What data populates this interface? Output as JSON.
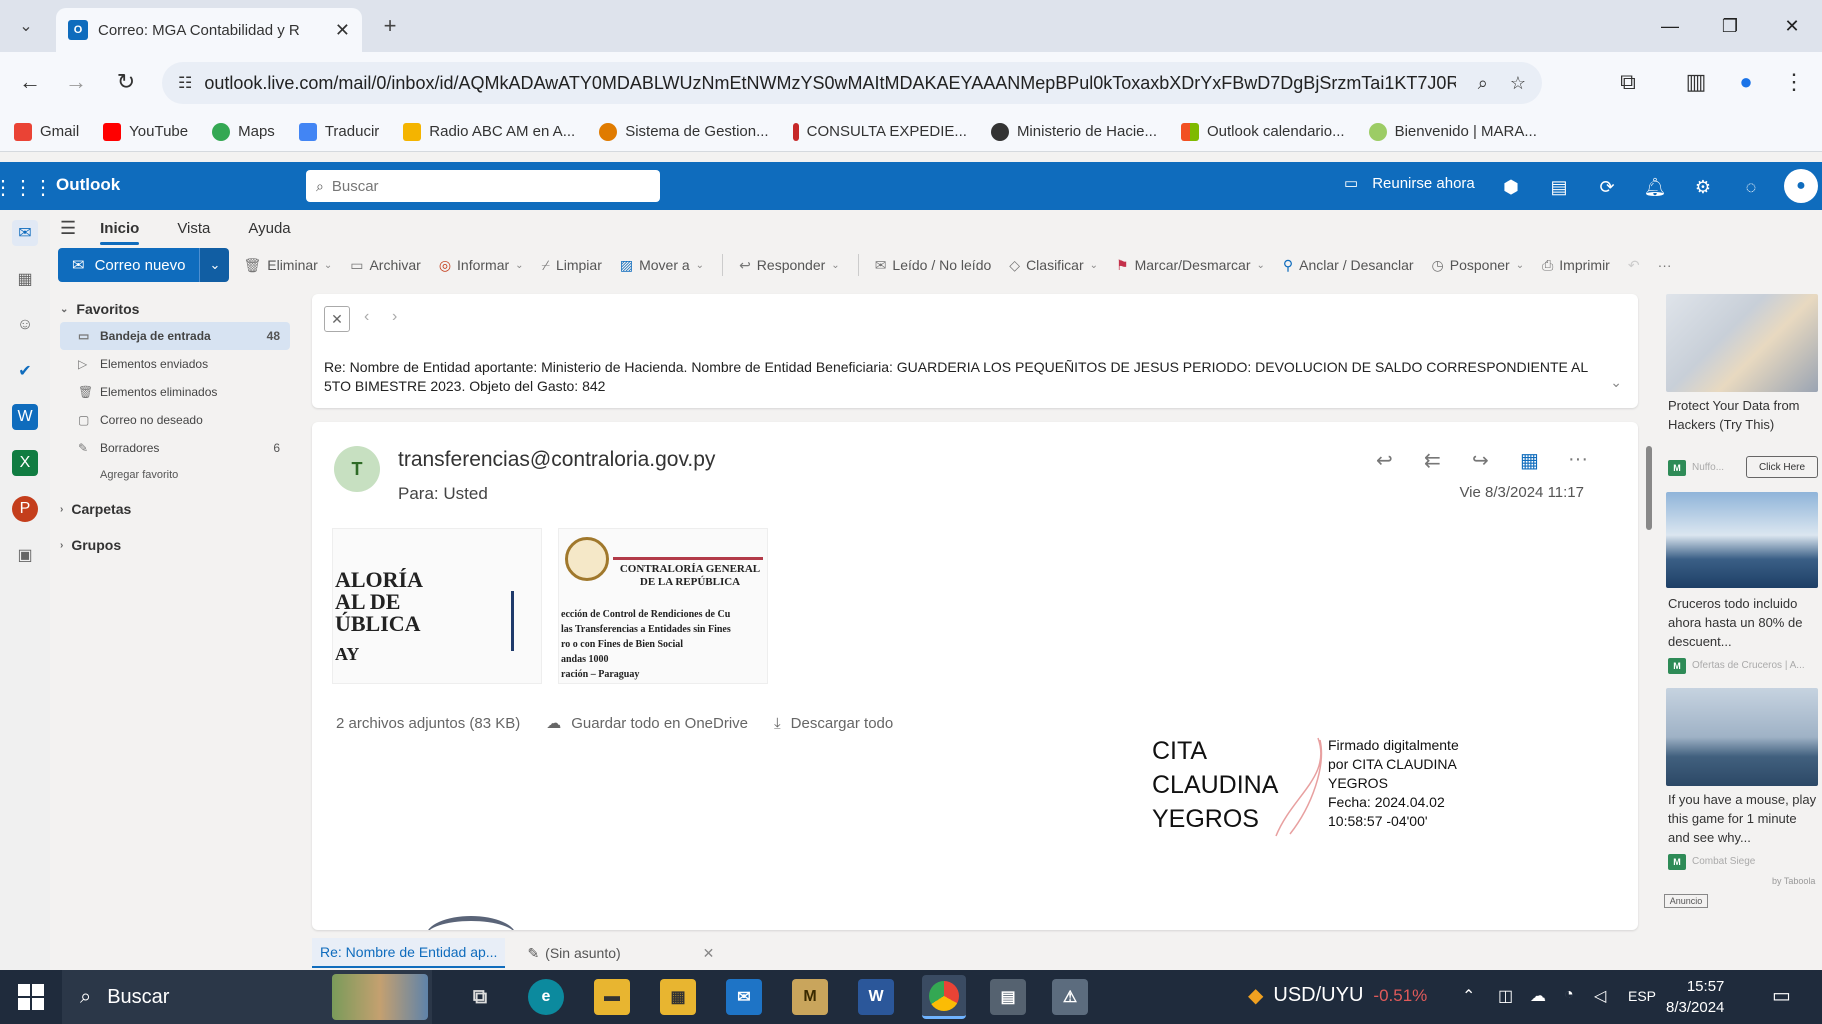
{
  "browser": {
    "tab_title": "Correo: MGA Contabilidad y R",
    "url": "outlook.live.com/mail/0/inbox/id/AQMkADAwATY0MDABLWUzNmEtNWMzYS0wMAItMDAKAEYAAANMepBPul0kToxaxbXDrYxFBwD7DgBjSrzmTai1KT7J0R...",
    "bookmarks": [
      {
        "label": "Gmail",
        "color": "#ea4335"
      },
      {
        "label": "YouTube",
        "color": "#ff0000"
      },
      {
        "label": "Maps",
        "color": "#34a853"
      },
      {
        "label": "Traducir",
        "color": "#4285f4"
      },
      {
        "label": "Radio ABC AM en A...",
        "color": "#f4b400"
      },
      {
        "label": "Sistema de Gestion...",
        "color": "#e07b00"
      },
      {
        "label": "CONSULTA EXPEDIE...",
        "color": "#c62828"
      },
      {
        "label": "Ministerio de Hacie...",
        "color": "#333333"
      },
      {
        "label": "Outlook calendario...",
        "color": "#f25022"
      },
      {
        "label": "Bienvenido | MARA...",
        "color": "#9ccc65"
      }
    ]
  },
  "outlook": {
    "brand": "Outlook",
    "search_placeholder": "Buscar",
    "meet_now": "Reunirse ahora",
    "ribbon_tabs": [
      "Inicio",
      "Vista",
      "Ayuda"
    ],
    "new_mail": "Correo nuevo",
    "ribbon": [
      "Eliminar",
      "Archivar",
      "Informar",
      "Limpiar",
      "Mover a",
      "Responder",
      "Leído / No leído",
      "Clasificar",
      "Marcar/Desmarcar",
      "Anclar / Desanclar",
      "Posponer",
      "Imprimir"
    ],
    "folders": {
      "favorites": "Favoritos",
      "items": [
        {
          "label": "Bandeja de entrada",
          "count": "48"
        },
        {
          "label": "Elementos enviados",
          "count": ""
        },
        {
          "label": "Elementos eliminados",
          "count": ""
        },
        {
          "label": "Correo no deseado",
          "count": ""
        },
        {
          "label": "Borradores",
          "count": "6"
        }
      ],
      "add_favorite": "Agregar favorito",
      "carpetas": "Carpetas",
      "grupos": "Grupos"
    },
    "subject": "Re: Nombre de Entidad aportante: Ministerio de Hacienda. Nombre de Entidad Beneficiaria: GUARDERIA LOS PEQUEÑITOS DE JESUS PERIODO: DEVOLUCION DE SALDO CORRESPONDIENTE AL 5TO BIMESTRE 2023. Objeto del Gasto: 842",
    "message": {
      "avatar_letter": "T",
      "sender": "transferencias@contraloria.gov.py",
      "to_label": "Para:",
      "to_value": "Usted",
      "date": "Vie 8/3/2024 11:17",
      "thumb1_lines": [
        "ALORÍA",
        "AL DE",
        "ÚBLICA",
        "AY"
      ],
      "thumb2_header": [
        "CONTRALORÍA GENERAL",
        "DE LA REPÚBLICA"
      ],
      "thumb2_lines": [
        "ección de Control de Rendiciones de Cu",
        "las Transferencias a Entidades sin Fines",
        "ro o con Fines de Bien Social",
        "andas 1000",
        "ración – Paraguay"
      ],
      "attachments": "2 archivos adjuntos (83 KB)",
      "save_onedrive": "Guardar todo en OneDrive",
      "download_all": "Descargar todo"
    },
    "signature": {
      "name_lines": [
        "CITA",
        "CLAUDINA",
        "YEGROS"
      ],
      "info_lines": [
        "Firmado digitalmente",
        "por CITA CLAUDINA",
        "YEGROS",
        "Fecha: 2024.04.02",
        "10:58:57 -04'00'"
      ]
    },
    "ads": [
      {
        "text": "Protect Your Data from Hackers (Try This)",
        "source": "Nuffo...",
        "cta": "Click Here"
      },
      {
        "text": "Cruceros todo incluido ahora hasta un 80% de descuent...",
        "source": "Ofertas de Cruceros | A..."
      },
      {
        "text": "If you have a mouse, play this game for 1 minute and see why...",
        "source": "Combat Siege"
      }
    ],
    "ad_label": "Anuncio",
    "by_label": "by Taboola",
    "draft_tabs": [
      "Re: Nombre de Entidad ap...",
      "(Sin asunto)"
    ]
  },
  "taskbar": {
    "search": "Buscar",
    "currency": "USD/UYU",
    "currency_change": "-0.51%",
    "lang": "ESP",
    "time": "15:57",
    "date": "8/3/2024"
  }
}
